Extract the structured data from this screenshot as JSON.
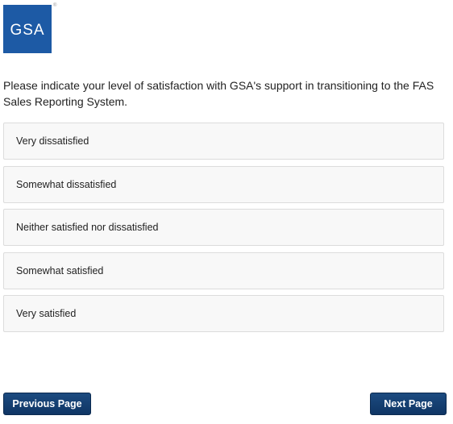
{
  "logo": {
    "text": "GSA",
    "mark": "®"
  },
  "question": "Please indicate your level of satisfaction with GSA's support in transitioning to the FAS Sales Reporting System.",
  "options": [
    {
      "label": "Very dissatisfied"
    },
    {
      "label": "Somewhat dissatisfied"
    },
    {
      "label": "Neither satisfied nor dissatisfied"
    },
    {
      "label": "Somewhat satisfied"
    },
    {
      "label": "Very satisfied"
    }
  ],
  "navigation": {
    "previous_label": "Previous Page",
    "next_label": "Next Page"
  },
  "colors": {
    "brand_blue": "#1d5aa5",
    "button_navy": "#133d6e"
  }
}
